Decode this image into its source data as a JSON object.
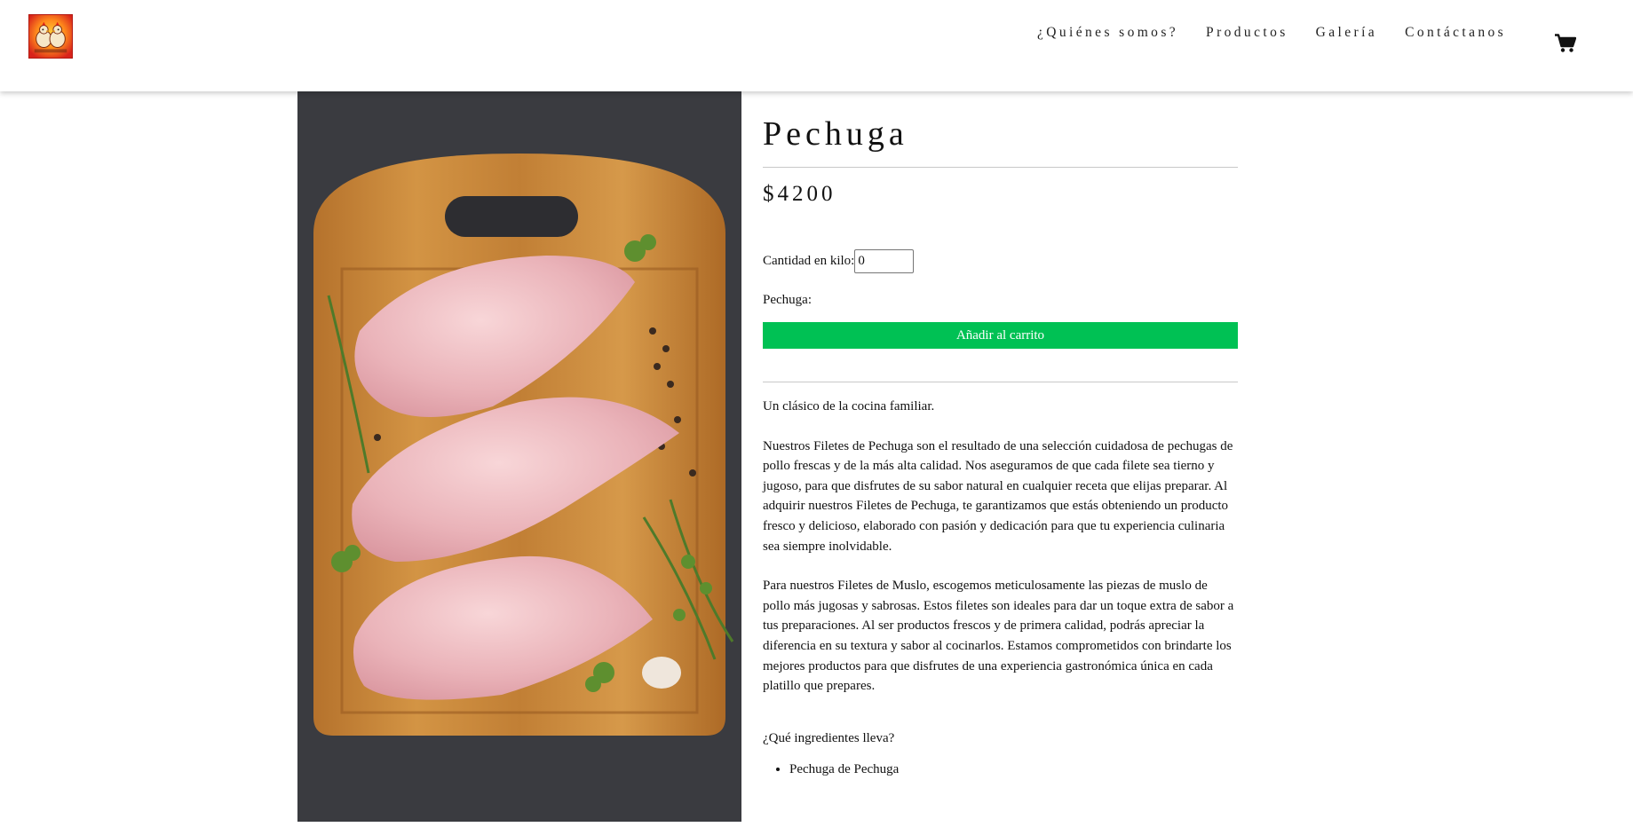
{
  "header": {
    "logo": {
      "name": "logo",
      "colors": [
        "#ffd23a",
        "#ff8a1c",
        "#d8231b"
      ]
    },
    "nav": [
      {
        "label": "¿Quiénes somos?"
      },
      {
        "label": "Productos"
      },
      {
        "label": "Galería"
      },
      {
        "label": "Contáctanos"
      }
    ],
    "cart_icon": "shopping-cart-icon"
  },
  "product": {
    "image": "chicken-breasts-on-cutting-board",
    "title": "Pechuga",
    "price": "$4200",
    "quantity_label": "Cantidad en kilo:",
    "quantity_value": "0",
    "variant_label": "Pechuga:",
    "add_to_cart_label": "Añadir al carrito",
    "add_to_cart_color": "#00c154",
    "description": [
      "Un clásico de la cocina familiar.",
      "Nuestros Filetes de Pechuga son el resultado de una selección cuidadosa de pechugas de pollo frescas y de la más alta calidad. Nos aseguramos de que cada filete sea tierno y jugoso, para que disfrutes de su sabor natural en cualquier receta que elijas preparar. Al adquirir nuestros Filetes de Pechuga, te garantizamos que estás obteniendo un producto fresco y delicioso, elaborado con pasión y dedicación para que tu experiencia culinaria sea siempre inolvidable.",
      "Para nuestros Filetes de Muslo, escogemos meticulosamente las piezas de muslo de pollo más jugosas y sabrosas. Estos filetes son ideales para dar un toque extra de sabor a tus preparaciones. Al ser productos frescos y de primera calidad, podrás apreciar la diferencia en su textura y sabor al cocinarlos. Estamos comprometidos con brindarte los mejores productos para que disfrutes de una experiencia gastronómica única en cada platillo que prepares."
    ],
    "ingredients_title": "¿Qué ingredientes lleva?",
    "ingredients": [
      "Pechuga de Pechuga"
    ]
  }
}
